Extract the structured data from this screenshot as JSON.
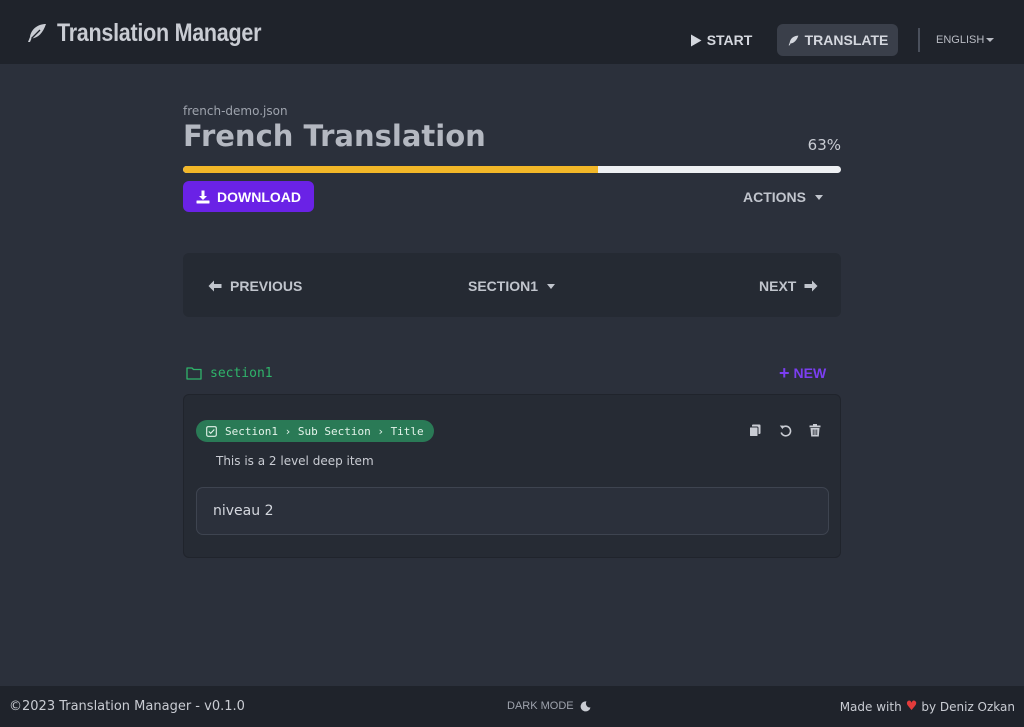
{
  "header": {
    "app_title": "Translation Manager",
    "nav": {
      "start_label": "START",
      "translate_label": "TRANSLATE"
    },
    "language": "ENGLISH"
  },
  "project": {
    "filename": "french-demo.json",
    "title": "French Translation",
    "progress_percent_label": "63%",
    "progress_fraction": 0.63,
    "download_label": "DOWNLOAD",
    "actions_label": "ACTIONS"
  },
  "section_nav": {
    "previous_label": "PREVIOUS",
    "current_section": "SECTION1",
    "next_label": "NEXT"
  },
  "section": {
    "name": "section1",
    "new_label": "NEW",
    "items": [
      {
        "path": "Section1 › Sub Section › Title",
        "description": "This is a 2 level deep item",
        "value": "niveau 2"
      }
    ]
  },
  "footer": {
    "copyright": "©2023 Translation Manager - v0.1.0",
    "dark_mode_label": "DARK MODE",
    "made_with": "Made with",
    "author": "by Deniz Ozkan"
  },
  "colors": {
    "accent": "#6a22e6",
    "progress": "#f2b728",
    "success": "#2fb36a",
    "heart": "#e23b3b"
  },
  "icons": {
    "brand": "feather-icon",
    "start": "play-icon",
    "translate": "feather-icon",
    "download": "download-icon",
    "previous": "arrow-left-icon",
    "next": "arrow-right-icon",
    "folder": "folder-icon",
    "pill": "checkbox-icon",
    "copy": "copy-icon",
    "reset": "undo-icon",
    "delete": "trash-icon",
    "dark_mode": "moon-icon"
  }
}
